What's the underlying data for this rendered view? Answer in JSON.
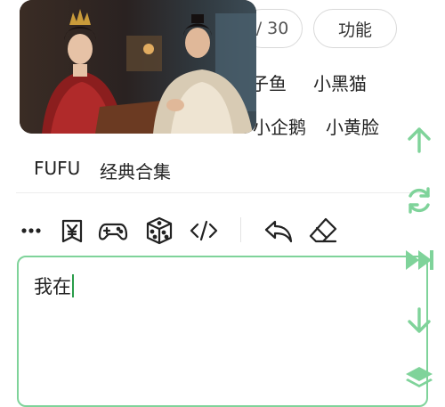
{
  "top": {
    "page_counter": "/ 30",
    "function_button": "功能"
  },
  "quick_items": {
    "row1": [
      "米子鱼",
      "小黑猫"
    ],
    "row2": [
      "小企鹅",
      "小黄脸"
    ],
    "row3": [
      "FUFU",
      "经典合集"
    ]
  },
  "toolbar": {
    "icons": [
      "more-icon",
      "yuan-icon",
      "gamepad-icon",
      "dice-icon",
      "code-icon",
      "undo-icon",
      "eraser-icon"
    ]
  },
  "editor": {
    "value": "我在"
  },
  "side_actions": {
    "icons": [
      "arrow-up-icon",
      "refresh-icon",
      "fast-forward-icon",
      "arrow-down-icon",
      "layers-icon"
    ],
    "color": "#7fd39a"
  },
  "overlay": {
    "type": "floating video player"
  }
}
